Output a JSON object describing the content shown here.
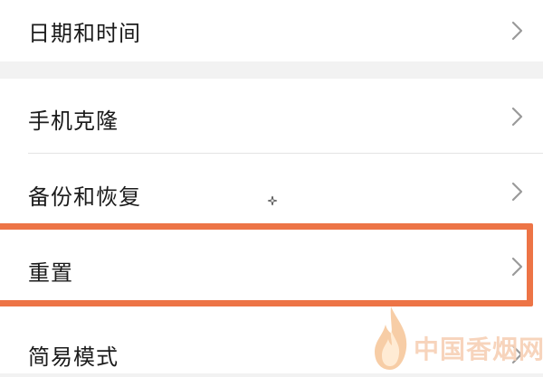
{
  "settings": {
    "items": [
      {
        "label": "日期和时间",
        "chevron": "chevron-right-icon"
      },
      {
        "label": "手机克隆",
        "chevron": "chevron-right-icon"
      },
      {
        "label": "备份和恢复",
        "chevron": "chevron-right-icon"
      },
      {
        "label": "重置",
        "chevron": "chevron-right-icon",
        "highlighted": true
      },
      {
        "label": "简易模式",
        "chevron": "chevron-right-icon"
      }
    ]
  },
  "highlight": {
    "color": "#ed7446"
  },
  "watermark": {
    "text": "中国香烟网",
    "icon": "flame-icon",
    "color": "#f7d2b8"
  }
}
